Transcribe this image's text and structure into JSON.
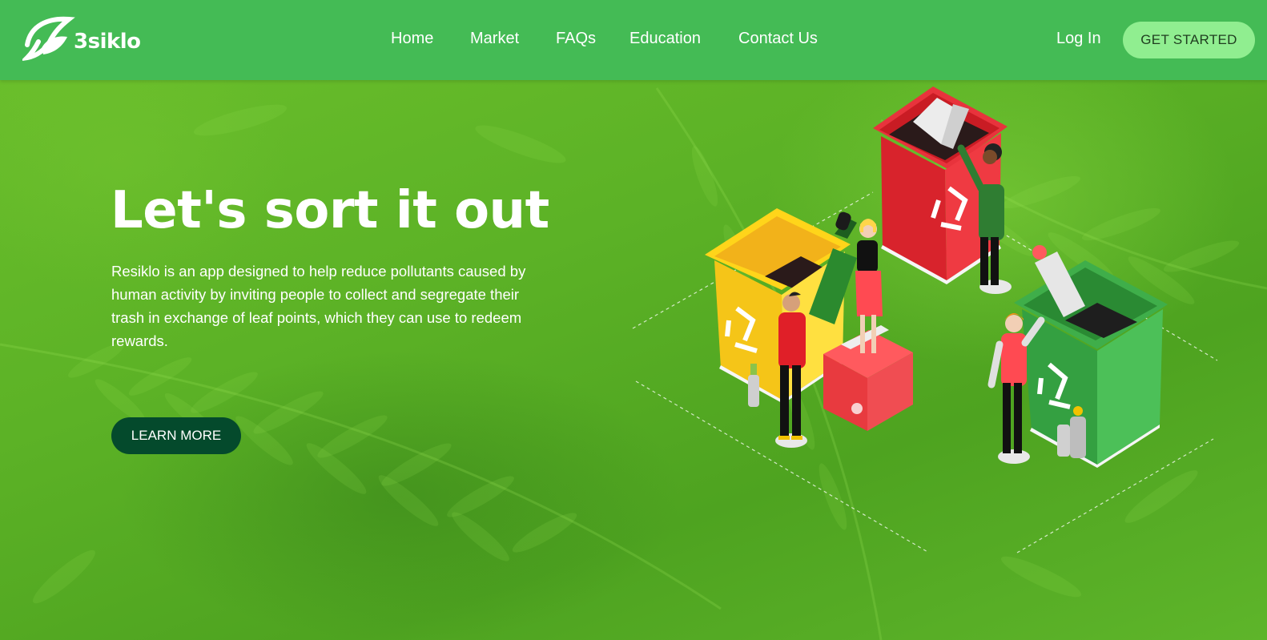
{
  "nav": {
    "logo_text": "3siklo",
    "links": [
      {
        "label": "Home"
      },
      {
        "label": "Market"
      },
      {
        "label": "FAQs"
      },
      {
        "label": "Education"
      },
      {
        "label": "Contact Us"
      }
    ],
    "login_label": "Log In",
    "cta_label": "GET STARTED"
  },
  "hero": {
    "headline": "Let's sort it out",
    "description": "Resiklo is an app designed to help reduce pollutants caused by human activity by inviting people to collect and segregate their trash in exchange of leaf points, which they can use to redeem rewards.",
    "button_label": "LEARN MORE"
  },
  "illustration": {
    "bins": [
      {
        "color": "yellow",
        "icon": "recycle-icon"
      },
      {
        "color": "red",
        "icon": "recycle-icon"
      },
      {
        "color": "green",
        "icon": "recycle-icon"
      }
    ]
  },
  "colors": {
    "navbar": "#44bb55",
    "cta_background": "#90ee90",
    "learn_more_background": "#044a2c",
    "hero_green": "#5eb52a"
  }
}
